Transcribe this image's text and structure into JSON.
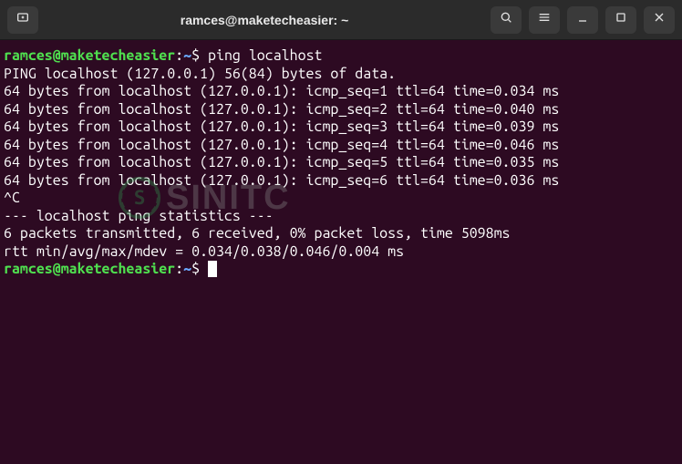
{
  "titlebar": {
    "title": "ramces@maketecheasier: ~",
    "buttons": {
      "new_tab": "new-tab",
      "search": "search",
      "menu": "menu",
      "minimize": "minimize",
      "maximize": "maximize",
      "close": "close"
    }
  },
  "prompt": {
    "user_host": "ramces@maketecheasier",
    "separator": ":",
    "path": "~",
    "symbol": "$"
  },
  "terminal": {
    "command": "ping localhost",
    "lines": [
      "PING localhost (127.0.0.1) 56(84) bytes of data.",
      "64 bytes from localhost (127.0.0.1): icmp_seq=1 ttl=64 time=0.034 ms",
      "64 bytes from localhost (127.0.0.1): icmp_seq=2 ttl=64 time=0.040 ms",
      "64 bytes from localhost (127.0.0.1): icmp_seq=3 ttl=64 time=0.039 ms",
      "64 bytes from localhost (127.0.0.1): icmp_seq=4 ttl=64 time=0.046 ms",
      "64 bytes from localhost (127.0.0.1): icmp_seq=5 ttl=64 time=0.035 ms",
      "64 bytes from localhost (127.0.0.1): icmp_seq=6 ttl=64 time=0.036 ms",
      "^C",
      "--- localhost ping statistics ---",
      "6 packets transmitted, 6 received, 0% packet loss, time 5098ms",
      "rtt min/avg/max/mdev = 0.034/0.038/0.046/0.004 ms"
    ]
  },
  "watermark": {
    "badge": "S",
    "text": "SINITC"
  }
}
